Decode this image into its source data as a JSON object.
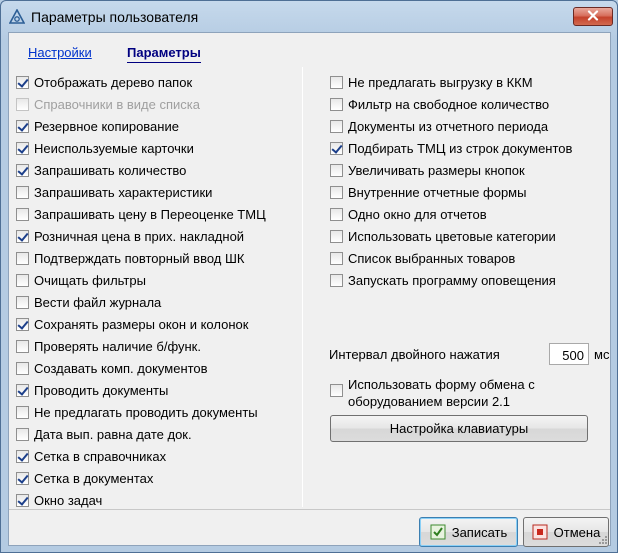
{
  "window": {
    "title": "Параметры пользователя"
  },
  "tabs": [
    {
      "label": "Настройки",
      "active": false
    },
    {
      "label": "Параметры",
      "active": true
    }
  ],
  "left_options": [
    {
      "label": "Отображать дерево папок",
      "checked": true,
      "enabled": true
    },
    {
      "label": "Справочники в виде списка",
      "checked": false,
      "enabled": false
    },
    {
      "label": "Резервное копирование",
      "checked": true,
      "enabled": true
    },
    {
      "label": "Неиспользуемые карточки",
      "checked": true,
      "enabled": true
    },
    {
      "label": "Запрашивать количество",
      "checked": true,
      "enabled": true
    },
    {
      "label": "Запрашивать характеристики",
      "checked": false,
      "enabled": true
    },
    {
      "label": "Запрашивать цену в Переоценке ТМЦ",
      "checked": false,
      "enabled": true
    },
    {
      "label": "Розничная цена в прих. накладной",
      "checked": true,
      "enabled": true
    },
    {
      "label": "Подтверждать повторный ввод ШК",
      "checked": false,
      "enabled": true
    },
    {
      "label": "Очищать фильтры",
      "checked": false,
      "enabled": true
    },
    {
      "label": "Вести файл журнала",
      "checked": false,
      "enabled": true
    },
    {
      "label": "Сохранять размеры окон и колонок",
      "checked": true,
      "enabled": true
    },
    {
      "label": "Проверять наличие б/функ.",
      "checked": false,
      "enabled": true
    },
    {
      "label": "Создавать комп. документов",
      "checked": false,
      "enabled": true
    },
    {
      "label": "Проводить документы",
      "checked": true,
      "enabled": true
    },
    {
      "label": "Не предлагать проводить документы",
      "checked": false,
      "enabled": true
    },
    {
      "label": "Дата вып. равна дате док.",
      "checked": false,
      "enabled": true
    },
    {
      "label": "Сетка в справочниках",
      "checked": true,
      "enabled": true
    },
    {
      "label": "Сетка в документах",
      "checked": true,
      "enabled": true
    },
    {
      "label": "Окно задач",
      "checked": true,
      "enabled": true
    }
  ],
  "right_options": [
    {
      "label": "Не предлагать выгрузку в ККМ",
      "checked": false,
      "enabled": true
    },
    {
      "label": "Фильтр на свободное количество",
      "checked": false,
      "enabled": true
    },
    {
      "label": "Документы из отчетного периода",
      "checked": false,
      "enabled": true
    },
    {
      "label": "Подбирать ТМЦ из строк документов",
      "checked": true,
      "enabled": true
    },
    {
      "label": "Увеличивать размеры кнопок",
      "checked": false,
      "enabled": true
    },
    {
      "label": "Внутренние отчетные формы",
      "checked": false,
      "enabled": true
    },
    {
      "label": "Одно окно для отчетов",
      "checked": false,
      "enabled": true
    },
    {
      "label": "Использовать цветовые категории",
      "checked": false,
      "enabled": true
    },
    {
      "label": "Список выбранных товаров",
      "checked": false,
      "enabled": true
    },
    {
      "label": "Запускать программу оповещения",
      "checked": false,
      "enabled": true
    }
  ],
  "interval": {
    "label": "Интервал двойного  нажатия",
    "value": "500",
    "unit": "мс"
  },
  "exchange_form": {
    "line1": "Использовать форму обмена с",
    "line2": "оборудованием версии 2.1",
    "checked": false
  },
  "buttons": {
    "keyboard": "Настройка клавиатуры",
    "save": "Записать",
    "cancel": "Отмена"
  },
  "colors": {
    "titlebar": "#b4cbe2",
    "close": "#c4422c",
    "link": "#0033cc",
    "check": "#1c3f8a"
  },
  "icons": {
    "app": "app-icon",
    "close": "close-icon",
    "save": "save-icon",
    "cancel": "cancel-icon"
  }
}
